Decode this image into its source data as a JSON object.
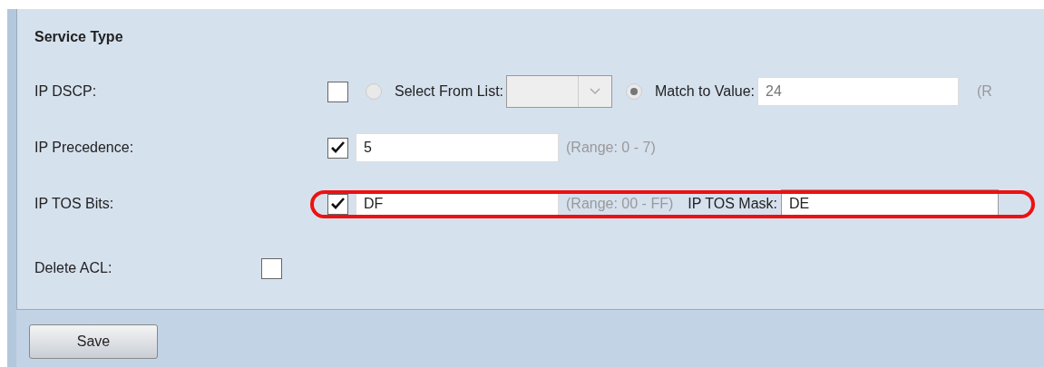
{
  "section_title": "Service Type",
  "rows": [
    {
      "kind": "dscp",
      "label": "IP DSCP:",
      "checked": false,
      "options": [
        {
          "label": "Select From List:",
          "selected": false
        },
        {
          "label": "Match to Value:",
          "selected": true
        }
      ],
      "value": "24",
      "hint": "(R",
      "highlighted": false
    },
    {
      "kind": "value",
      "label": "IP Precedence:",
      "checked": true,
      "value": "5",
      "hint": "(Range: 0 - 7)",
      "highlighted": false
    },
    {
      "kind": "tos",
      "label": "IP TOS Bits:",
      "checked": true,
      "value": "DF",
      "hint": "(Range: 00 - FF)",
      "mask_label": "IP TOS Mask:",
      "mask_value": "DE",
      "highlighted": true
    },
    {
      "kind": "delete",
      "label": "Delete ACL:",
      "checked": false,
      "highlighted": false
    }
  ],
  "buttons": [
    {
      "label": "Save"
    }
  ]
}
